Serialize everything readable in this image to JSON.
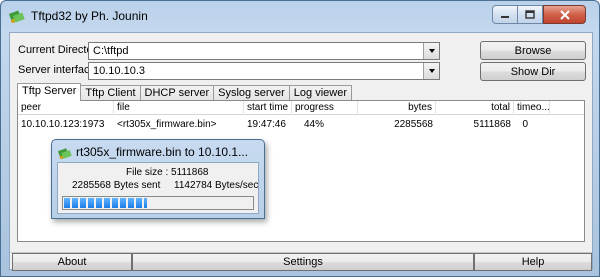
{
  "window": {
    "title": "Tftpd32 by Ph. Jounin"
  },
  "form": {
    "current_directory_label": "Current Directory",
    "current_directory_value": "C:\\tftpd",
    "server_interfaces_label": "Server interfaces",
    "server_interfaces_value": "10.10.10.3",
    "browse_button": "Browse",
    "show_dir_button": "Show Dir"
  },
  "tabs": [
    {
      "label": "Tftp Server",
      "active": true
    },
    {
      "label": "Tftp Client",
      "active": false
    },
    {
      "label": "DHCP server",
      "active": false
    },
    {
      "label": "Syslog server",
      "active": false
    },
    {
      "label": "Log viewer",
      "active": false
    }
  ],
  "table": {
    "columns": [
      "peer",
      "file",
      "start time",
      "progress",
      "bytes",
      "total",
      "timeo..."
    ],
    "rows": [
      {
        "peer": "10.10.10.123:1973",
        "file": "<rt305x_firmware.bin>",
        "start_time": "19:47:46",
        "progress": "44%",
        "bytes": "2285568",
        "total": "5111868",
        "timeout": "0"
      }
    ]
  },
  "bottom": {
    "about": "About",
    "settings": "Settings",
    "help": "Help"
  },
  "popup": {
    "title": "rt305x_firmware.bin to 10.10.1...",
    "file_size": "File size : 5111868",
    "bytes_sent": "2285568 Bytes sent",
    "rate": "1142784 Bytes/sec",
    "progress": 0.44
  },
  "colors": {
    "titlebar": "#b9d1ea",
    "progress_fill": "#1a7ee6",
    "close_button": "#c14430"
  }
}
